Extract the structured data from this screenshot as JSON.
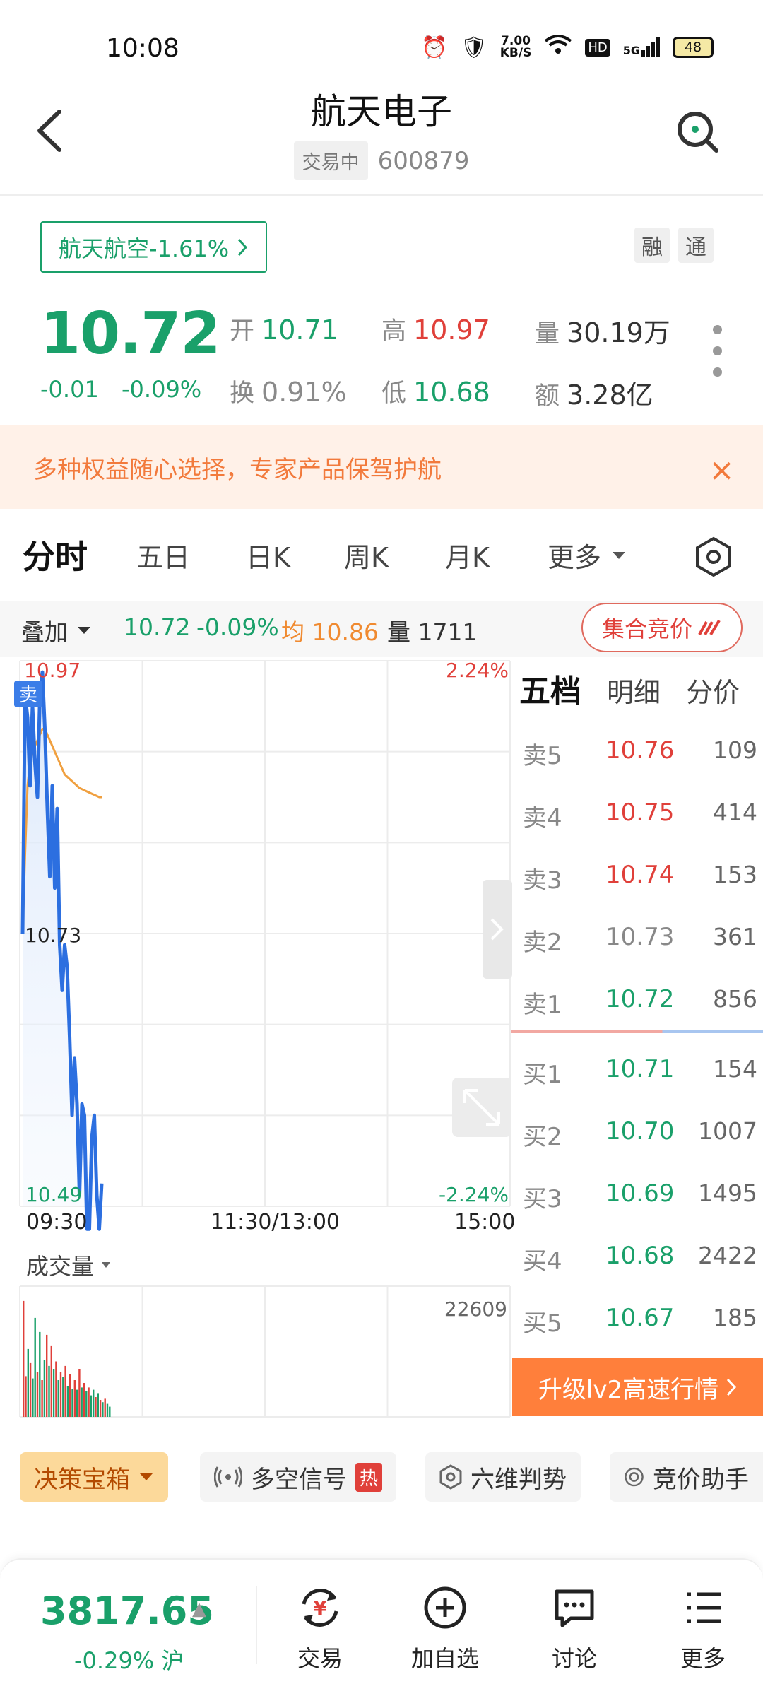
{
  "status_bar": {
    "time": "10:08",
    "net_speed_value": "7.00",
    "net_speed_unit": "KB/S",
    "hd": "HD",
    "signal": "5G",
    "battery": "48"
  },
  "header": {
    "title": "航天电子",
    "status_badge": "交易中",
    "code": "600879"
  },
  "sector": {
    "label": "航天航空-1.61%"
  },
  "mini_tags": [
    "融",
    "通"
  ],
  "quote": {
    "price": "10.72",
    "change": "-0.01",
    "change_pct": "-0.09%",
    "open_label": "开",
    "open": "10.71",
    "high_label": "高",
    "high": "10.97",
    "volume_label": "量",
    "volume": "30.19万",
    "turnover_label": "换",
    "turnover": "0.91%",
    "low_label": "低",
    "low": "10.68",
    "amount_label": "额",
    "amount": "3.28亿"
  },
  "promo": {
    "text": "多种权益随心选择，专家产品保驾护航",
    "close": "×"
  },
  "tabs": [
    "分时",
    "五日",
    "日K",
    "周K",
    "月K",
    "更多"
  ],
  "overlay_bar": {
    "overlay": "叠加",
    "price": "10.72",
    "pct": "-0.09%",
    "avg": "均 10.86",
    "vol": "量 1711",
    "auction": "集合竞价"
  },
  "chart_data": {
    "type": "line",
    "title": "",
    "x_ticks": [
      "09:30",
      "11:30/13:00",
      "15:00"
    ],
    "ylim": [
      10.49,
      10.97
    ],
    "y_left_top": "10.97",
    "y_left_bottom": "10.49",
    "y_right_top": "2.24%",
    "y_right_bottom": "-2.24%",
    "current_price_label": "10.73",
    "sell_marker": "卖",
    "price_series": [
      10.73,
      10.94,
      10.92,
      10.86,
      10.93,
      10.88,
      10.85,
      10.94,
      10.96,
      10.91,
      10.84,
      10.78,
      10.86,
      10.77,
      10.84,
      10.72,
      10.68,
      10.72,
      10.7,
      10.64,
      10.57,
      10.62,
      10.58,
      10.5,
      10.58,
      10.57,
      10.47,
      10.47,
      10.55,
      10.57,
      10.5,
      10.47,
      10.51
    ],
    "avg_series": [
      10.73,
      10.8,
      10.86,
      10.88,
      10.89,
      10.895,
      10.9,
      10.905,
      10.91,
      10.91,
      10.905,
      10.9,
      10.895,
      10.89,
      10.885,
      10.88,
      10.875,
      10.87,
      10.868,
      10.866,
      10.864,
      10.862,
      10.86,
      10.858,
      10.857,
      10.856,
      10.855,
      10.854,
      10.853,
      10.852,
      10.851,
      10.85,
      10.85
    ],
    "volume_title": "成交量",
    "volume_max_label": "22609",
    "volume_max": 22609,
    "volume_series": [
      20500,
      7200,
      12000,
      9500,
      6800,
      17500,
      8000,
      15000,
      6500,
      10000,
      14500,
      9000,
      12500,
      8500,
      9800,
      6500,
      8000,
      7000,
      9000,
      5500,
      7500,
      5000,
      6500,
      4800,
      8500,
      5200,
      6000,
      4500,
      5200,
      3800,
      4800,
      3500,
      4200,
      3000,
      2600,
      3200,
      2300,
      1800
    ],
    "volume_colors": [
      "r",
      "r",
      "g",
      "r",
      "g",
      "g",
      "r",
      "g",
      "r",
      "g",
      "r",
      "g",
      "r",
      "g",
      "r",
      "g",
      "r",
      "g",
      "r",
      "g",
      "r",
      "g",
      "r",
      "g",
      "r",
      "g",
      "r",
      "g",
      "r",
      "g",
      "g",
      "r",
      "g",
      "r",
      "g",
      "r",
      "g",
      "g"
    ]
  },
  "order_book": {
    "tabs": [
      "五档",
      "明细",
      "分价"
    ],
    "asks": [
      {
        "label": "卖5",
        "price": "10.76",
        "vol": "109",
        "color": "red"
      },
      {
        "label": "卖4",
        "price": "10.75",
        "vol": "414",
        "color": "red"
      },
      {
        "label": "卖3",
        "price": "10.74",
        "vol": "153",
        "color": "red"
      },
      {
        "label": "卖2",
        "price": "10.73",
        "vol": "361",
        "color": "gray"
      },
      {
        "label": "卖1",
        "price": "10.72",
        "vol": "856",
        "color": "green"
      }
    ],
    "bids": [
      {
        "label": "买1",
        "price": "10.71",
        "vol": "154",
        "color": "green"
      },
      {
        "label": "买2",
        "price": "10.70",
        "vol": "1007",
        "color": "green"
      },
      {
        "label": "买3",
        "price": "10.69",
        "vol": "1495",
        "color": "green"
      },
      {
        "label": "买4",
        "price": "10.68",
        "vol": "2422",
        "color": "green"
      },
      {
        "label": "买5",
        "price": "10.67",
        "vol": "185",
        "color": "green"
      }
    ],
    "upgrade": "升级lv2高速行情"
  },
  "tools": [
    "决策宝箱",
    "多空信号",
    "六维判势",
    "竞价助手"
  ],
  "tools_hot_badge": "热",
  "bottom_bar": {
    "index_price": "3817.65",
    "index_change": "-0.29%",
    "index_market": "沪",
    "nav": [
      "交易",
      "加自选",
      "讨论",
      "更多"
    ]
  },
  "colors": {
    "up": "#e0403a",
    "down": "#1aa06a",
    "price_line": "#2c6fe0",
    "avg_line": "#f0a040",
    "accent": "#ff7f3b"
  }
}
